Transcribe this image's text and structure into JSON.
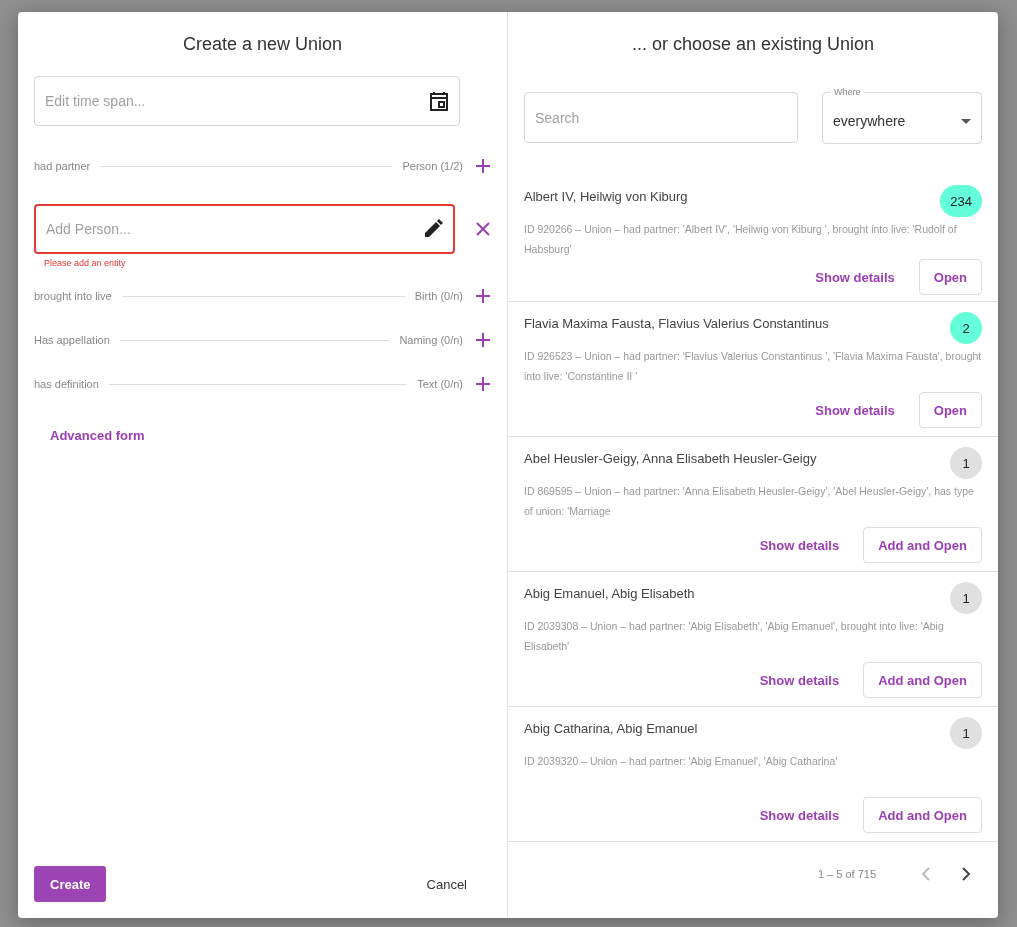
{
  "create_panel": {
    "title": "Create a new Union",
    "time_span_field": {
      "placeholder": "Edit time span..."
    },
    "relations": [
      {
        "label": "had partner",
        "target": "Person",
        "count": "(1/2)",
        "entries": [
          {
            "placeholder": "Add Person...",
            "error": "Please add an entity"
          }
        ]
      },
      {
        "label": "brought into live",
        "target": "Birth",
        "count": "(0/n)"
      },
      {
        "label": "Has appellation",
        "target": "Naming",
        "count": "(0/n)"
      },
      {
        "label": "has definition",
        "target": "Text",
        "count": "(0/n)"
      }
    ],
    "advanced_link": "Advanced form",
    "create_button": "Create",
    "cancel_button": "Cancel"
  },
  "choose_panel": {
    "title": "... or choose an existing Union",
    "search": {
      "placeholder": "Search"
    },
    "where": {
      "label": "Where",
      "value": "everywhere"
    },
    "results": [
      {
        "title": "Albert IV, Heilwig von Kiburg",
        "count": "234",
        "color": "#64ffda",
        "description": "ID 920266 – Union – had partner: 'Albert IV', 'Heilwig von Kiburg ', brought into live: 'Rudolf of Habsburg'",
        "details": "Show details",
        "action": "Open"
      },
      {
        "title": "Flavia Maxima Fausta, Flavius Valerius Constantinus",
        "count": "2",
        "color": "#64ffda",
        "description": "ID 926523 – Union – had partner: 'Flavius Valerius Constantinus ', 'Flavia Maxima Fausta', brought into live: 'Constantine II '",
        "details": "Show details",
        "action": "Open"
      },
      {
        "title": "Abel Heusler-Geigy, Anna Elisabeth Heusler-Geigy",
        "count": "1",
        "color": "#e0e0e0",
        "description": "ID 869595 – Union – had partner: 'Anna Elisabeth Heusler-Geigy', 'Abel Heusler-Geigy', has type of union: 'Marriage",
        "details": "Show details",
        "action": "Add and Open"
      },
      {
        "title": "Abig Emanuel, Abig Elisabeth",
        "count": "1",
        "color": "#e0e0e0",
        "description": "ID 2039308 – Union – had partner: 'Abig Elisabeth', 'Abig Emanuel', brought into live: 'Abig Elisabeth'",
        "details": "Show details",
        "action": "Add and Open"
      },
      {
        "title": "Abig Catharina, Abig Emanuel",
        "count": "1",
        "color": "#e0e0e0",
        "description": "ID 2039320 – Union – had partner: 'Abig Emanuel', 'Abig Catharina'",
        "details": "Show details",
        "action": "Add and Open"
      }
    ],
    "pagination": {
      "range": "1 – 5 of 715",
      "previous_disabled": true,
      "next_disabled": false
    }
  }
}
